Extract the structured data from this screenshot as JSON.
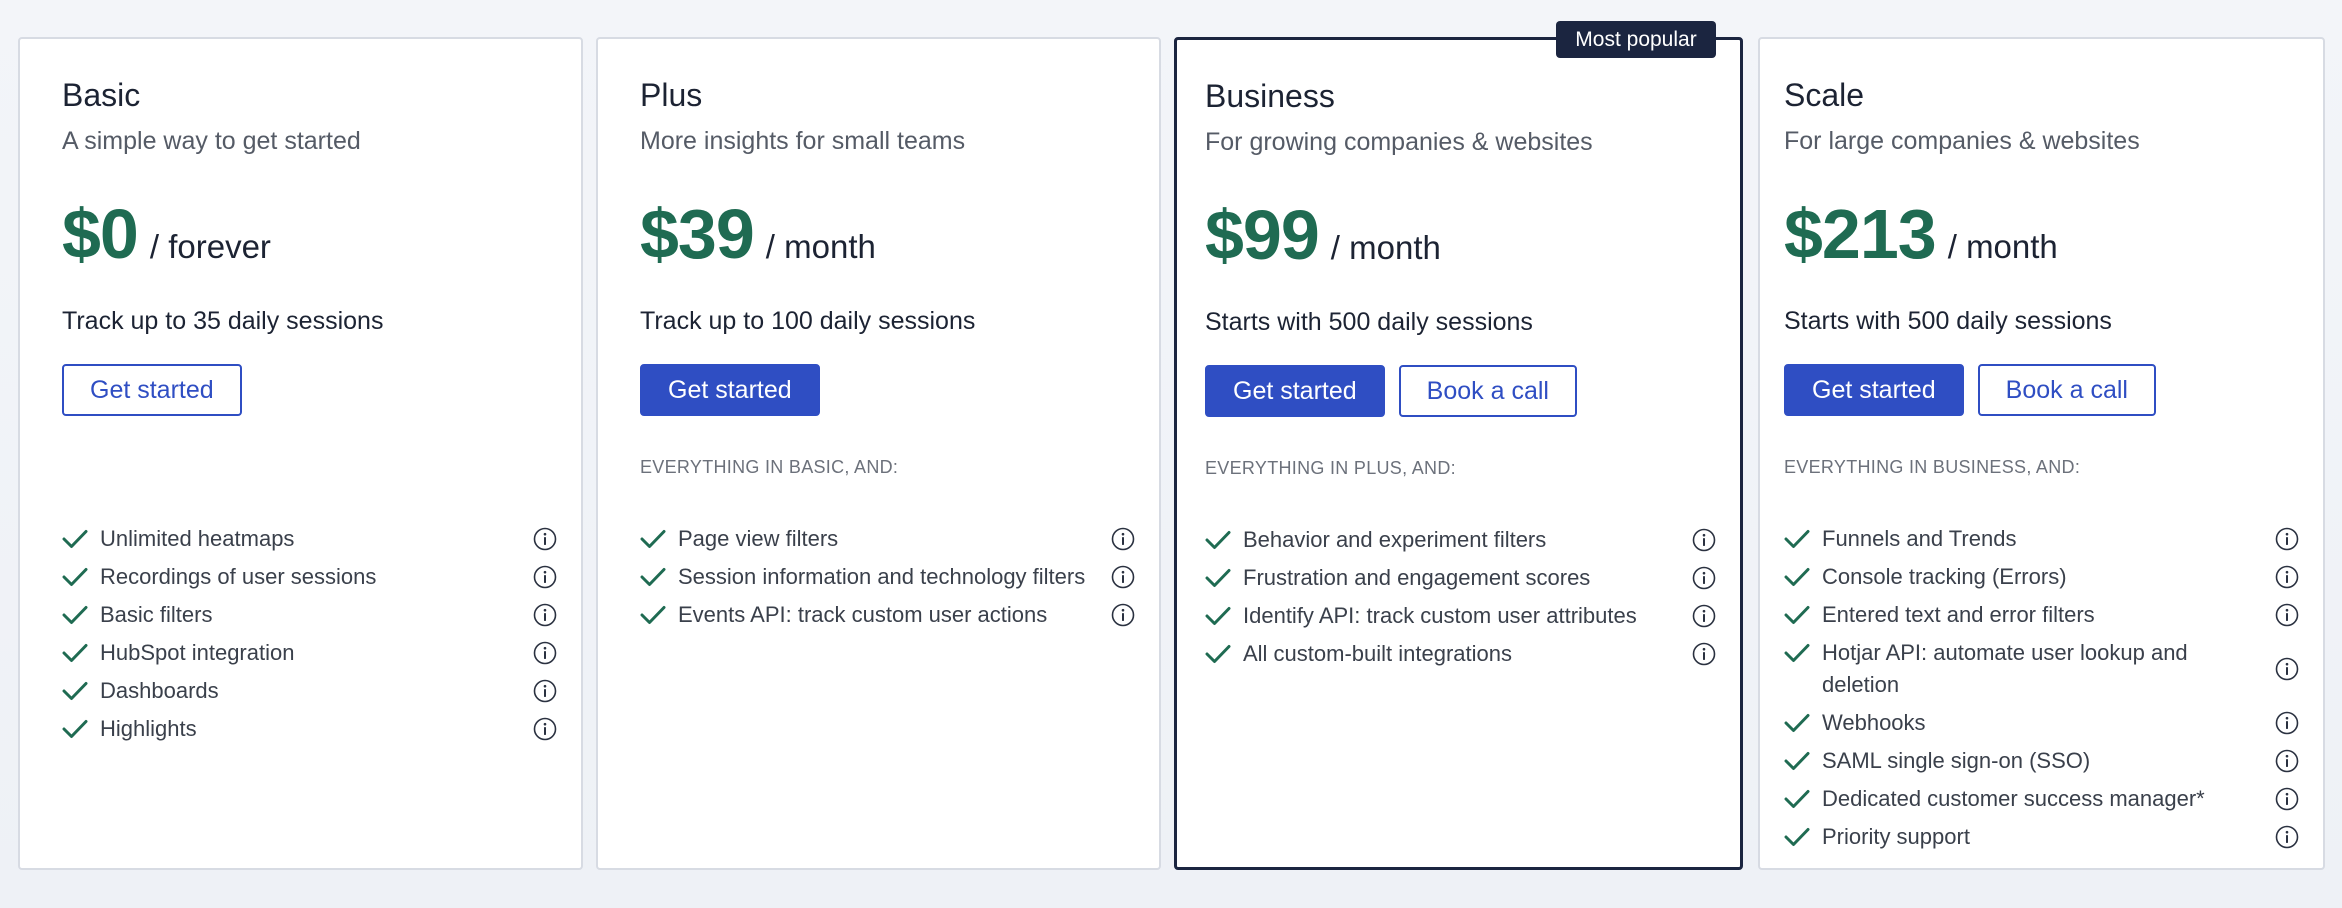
{
  "badge": "Most popular",
  "plans": [
    {
      "name": "Basic",
      "description": "A simple way to get started",
      "price": "$0",
      "period": "/ forever",
      "sessions": "Track up to 35 daily sessions",
      "primary_button": "Get started",
      "secondary_button": null,
      "section_label": "",
      "features": [
        "Unlimited heatmaps",
        "Recordings of user sessions",
        "Basic filters",
        "HubSpot integration",
        "Dashboards",
        "Highlights"
      ]
    },
    {
      "name": "Plus",
      "description": "More insights for small teams",
      "price": "$39",
      "period": "/ month",
      "sessions": "Track up to 100 daily sessions",
      "primary_button": "Get started",
      "secondary_button": null,
      "section_label": "EVERYTHING IN BASIC, AND:",
      "features": [
        "Page view filters",
        "Session information and technology filters",
        "Events API: track custom user actions"
      ]
    },
    {
      "name": "Business",
      "description": "For growing companies & websites",
      "price": "$99",
      "period": "/ month",
      "sessions": "Starts with 500 daily sessions",
      "primary_button": "Get started",
      "secondary_button": "Book a call",
      "section_label": "EVERYTHING IN PLUS, AND:",
      "features": [
        "Behavior and experiment filters",
        "Frustration and engagement scores",
        "Identify API: track custom user attributes",
        "All custom-built integrations"
      ]
    },
    {
      "name": "Scale",
      "description": "For large companies & websites",
      "price": "$213",
      "period": "/ month",
      "sessions": "Starts with 500 daily sessions",
      "primary_button": "Get started",
      "secondary_button": "Book a call",
      "section_label": "EVERYTHING IN BUSINESS, AND:",
      "features": [
        "Funnels and Trends",
        "Console tracking (Errors)",
        "Entered text and error filters",
        "Hotjar API: automate user lookup and deletion",
        "Webhooks",
        "SAML single sign-on (SSO)",
        "Dedicated customer success manager*",
        "Priority support"
      ]
    }
  ],
  "colors": {
    "price": "#1f6b52",
    "accent": "#2f4ec3",
    "featured_border": "#1b2540",
    "check": "#1f6b52"
  },
  "icons": {
    "check": "check-icon",
    "info": "info-icon"
  }
}
